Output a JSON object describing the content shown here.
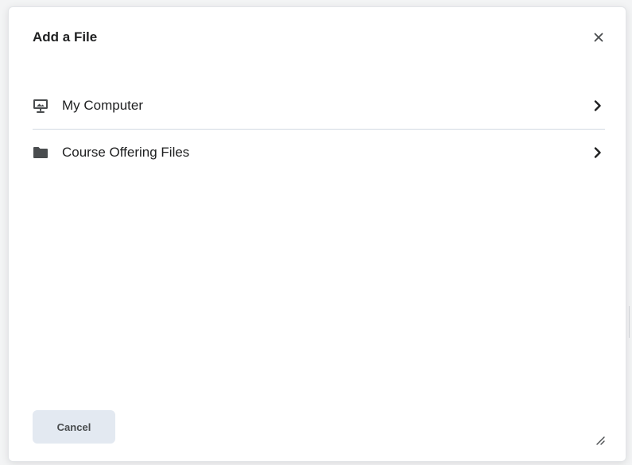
{
  "dialog": {
    "title": "Add a File",
    "close_icon": "close-icon",
    "sources": [
      {
        "label": "My Computer",
        "icon": "computer-upload-icon"
      },
      {
        "label": "Course Offering Files",
        "icon": "folder-icon"
      }
    ],
    "cancel_label": "Cancel"
  },
  "colors": {
    "text": "#202122",
    "muted": "#494c4e",
    "divider": "#d3d9e3",
    "button_bg": "#e3e9f1"
  }
}
